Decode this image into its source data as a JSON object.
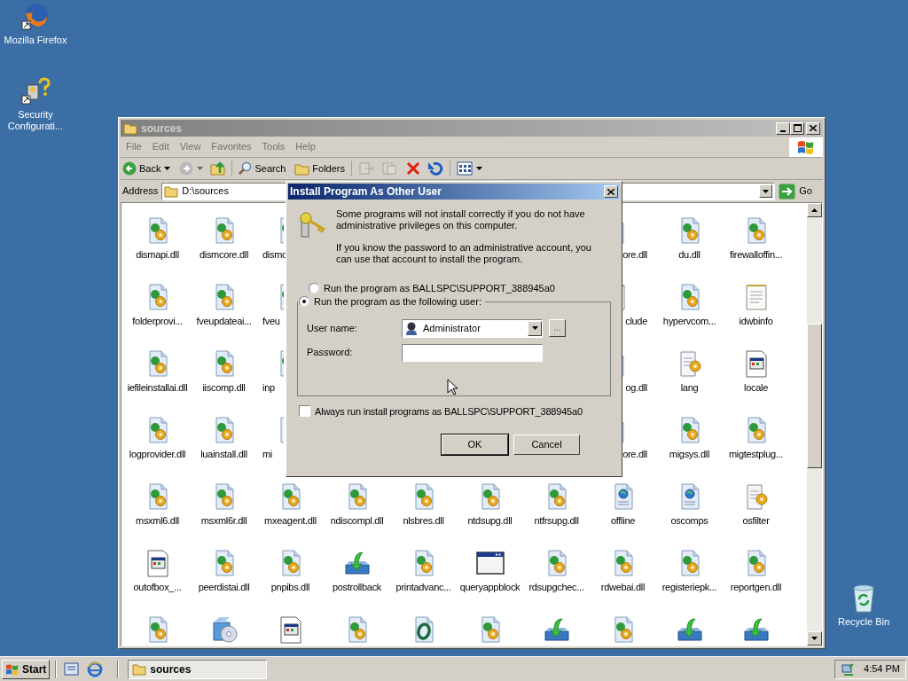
{
  "desktop_icons": [
    {
      "label": "Mozilla Firefox",
      "kind": "firefox"
    },
    {
      "label": "Security Configurati...",
      "kind": "security"
    },
    {
      "label": "Recycle Bin",
      "kind": "recycle"
    }
  ],
  "explorer": {
    "title": "sources",
    "menu": [
      "File",
      "Edit",
      "View",
      "Favorites",
      "Tools",
      "Help"
    ],
    "toolbar": {
      "back": "Back",
      "search": "Search",
      "folders": "Folders"
    },
    "address": {
      "label": "Address",
      "value": "D:\\sources",
      "go": "Go"
    },
    "rows": [
      {
        "left": [
          {
            "label": "dismapi.dll",
            "kind": "dll"
          },
          {
            "label": "dismcore.dll",
            "kind": "dll"
          },
          {
            "label": "dismc",
            "kind": "dll"
          }
        ],
        "right": [
          {
            "label": "ore.dll",
            "kind": "dll"
          },
          {
            "label": "du.dll",
            "kind": "dll"
          },
          {
            "label": "firewalloffin...",
            "kind": "dll"
          }
        ]
      },
      {
        "left": [
          {
            "label": "folderprovi...",
            "kind": "dll"
          },
          {
            "label": "fveupdateai...",
            "kind": "dll"
          },
          {
            "label": "fveu",
            "kind": "dll"
          }
        ],
        "right": [
          {
            "label": "clude",
            "kind": "text"
          },
          {
            "label": "hypervcom...",
            "kind": "dll"
          },
          {
            "label": "idwbinfo",
            "kind": "text"
          }
        ]
      },
      {
        "left": [
          {
            "label": "iefileinstallai.dll",
            "kind": "dll"
          },
          {
            "label": "iiscomp.dll",
            "kind": "dll"
          },
          {
            "label": "inp",
            "kind": "dll"
          }
        ],
        "right": [
          {
            "label": "og.dll",
            "kind": "dll"
          },
          {
            "label": "lang",
            "kind": "config"
          },
          {
            "label": "locale",
            "kind": "window"
          }
        ]
      },
      {
        "left": [
          {
            "label": "logprovider.dll",
            "kind": "dll"
          },
          {
            "label": "luainstall.dll",
            "kind": "dll"
          },
          {
            "label": "mi",
            "kind": "web"
          }
        ],
        "right": [
          {
            "label": "ore.dll",
            "kind": "dll"
          },
          {
            "label": "migsys.dll",
            "kind": "dll"
          },
          {
            "label": "migtestplug...",
            "kind": "dll"
          }
        ]
      },
      {
        "items": [
          {
            "label": "msxml6.dll",
            "kind": "dll"
          },
          {
            "label": "msxml6r.dll",
            "kind": "dll"
          },
          {
            "label": "mxeagent.dll",
            "kind": "dll"
          },
          {
            "label": "ndiscompl.dll",
            "kind": "dll"
          },
          {
            "label": "nlsbres.dll",
            "kind": "dll"
          },
          {
            "label": "ntdsupg.dll",
            "kind": "dll"
          },
          {
            "label": "ntfrsupg.dll",
            "kind": "dll"
          },
          {
            "label": "offline",
            "kind": "web"
          },
          {
            "label": "oscomps",
            "kind": "web"
          },
          {
            "label": "osfilter",
            "kind": "config"
          }
        ]
      },
      {
        "items": [
          {
            "label": "outofbox_...",
            "kind": "window"
          },
          {
            "label": "peerdistai.dll",
            "kind": "dll"
          },
          {
            "label": "pnpibs.dll",
            "kind": "dll"
          },
          {
            "label": "postrollback",
            "kind": "setup"
          },
          {
            "label": "printadvanc...",
            "kind": "dll"
          },
          {
            "label": "queryappblock",
            "kind": "app"
          },
          {
            "label": "rdsupgchec...",
            "kind": "dll"
          },
          {
            "label": "rdwebai.dll",
            "kind": "dll"
          },
          {
            "label": "registeriepk...",
            "kind": "dll"
          },
          {
            "label": "reportgen.dll",
            "kind": "dll"
          }
        ]
      },
      {
        "items": [
          {
            "kind": "dll"
          },
          {
            "kind": "cd"
          },
          {
            "kind": "window"
          },
          {
            "kind": "dll"
          },
          {
            "kind": "logo"
          },
          {
            "kind": "dll"
          },
          {
            "kind": "setup"
          },
          {
            "kind": "dll"
          },
          {
            "kind": "setup"
          },
          {
            "kind": "setup"
          }
        ]
      }
    ]
  },
  "dialog": {
    "title": "Install Program As Other User",
    "paragraphs": [
      "Some programs will not install correctly if you do not have administrative privileges on this computer.",
      "If you know the password to an administrative account, you can use that account to install the program."
    ],
    "options": [
      {
        "label": "Run the program as BALLSPC\\SUPPORT_388945a0",
        "selected": false
      },
      {
        "label": "Run the program as the following user:",
        "selected": true
      }
    ],
    "user_name": {
      "label": "User name:",
      "value": "Administrator",
      "browse": "..."
    },
    "password": {
      "label": "Password:"
    },
    "always": {
      "label": "Always run install programs as BALLSPC\\SUPPORT_388945a0",
      "checked": false
    },
    "buttons": [
      "OK",
      "Cancel"
    ]
  },
  "taskbar": {
    "start": "Start",
    "tasks": [
      {
        "label": "sources",
        "selected": true
      }
    ],
    "clock": "4:54 PM"
  }
}
